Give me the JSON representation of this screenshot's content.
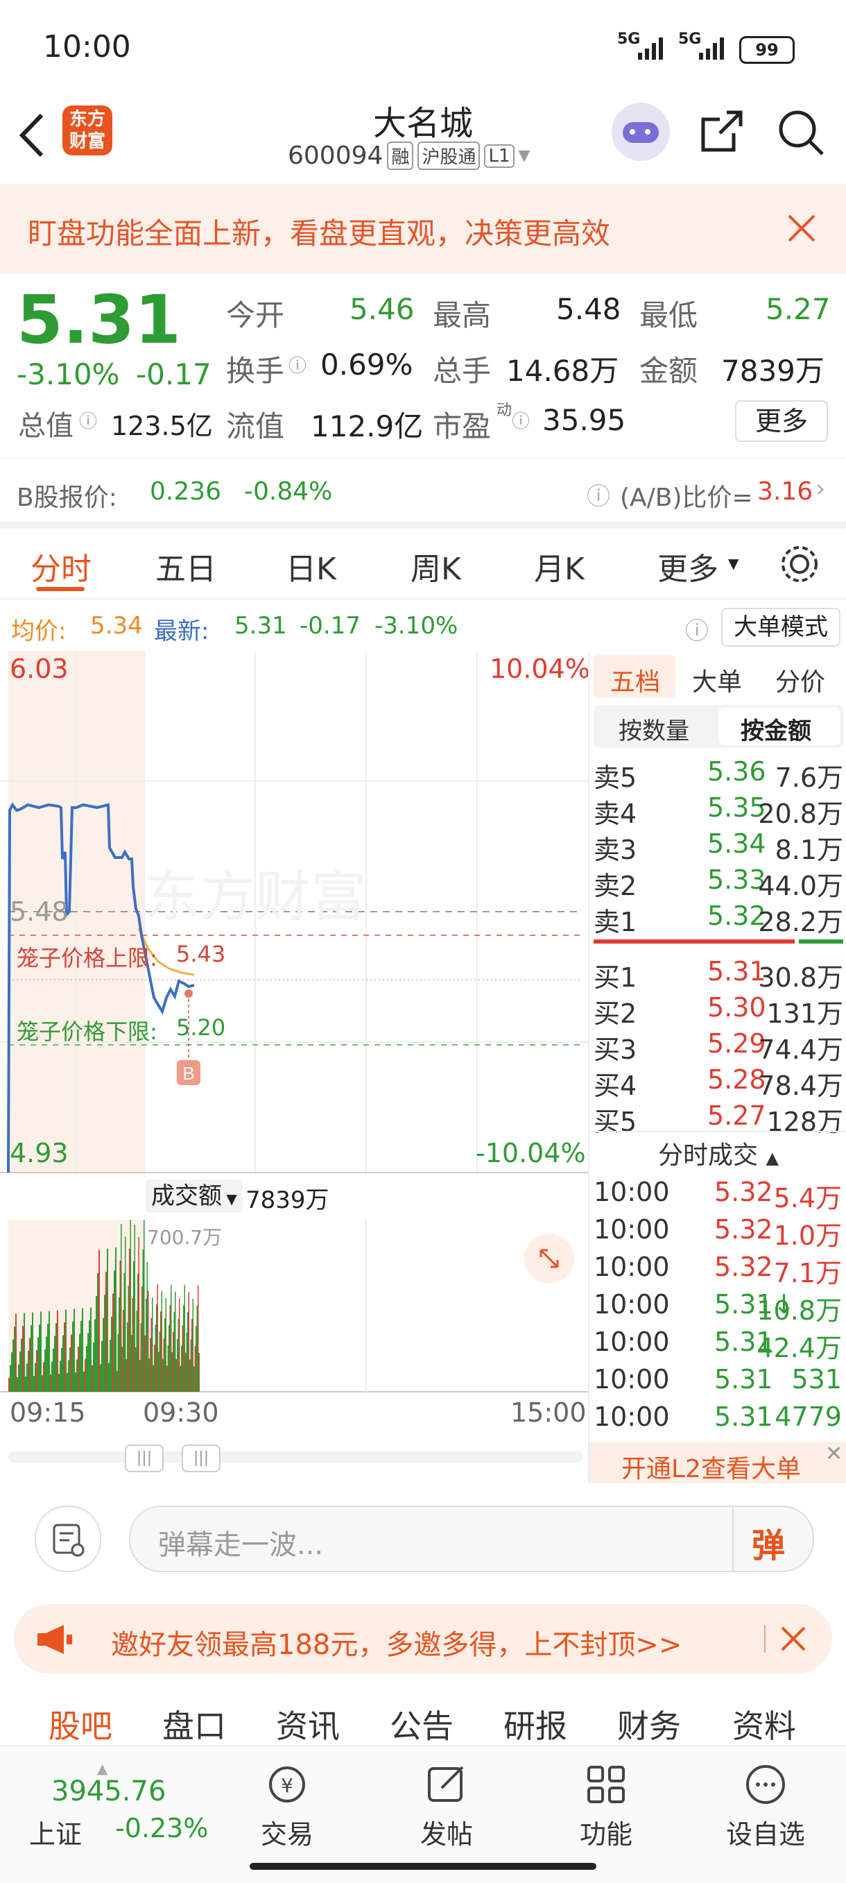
{
  "status": {
    "time": "10:00",
    "signal1": "5G",
    "signal2": "5G",
    "battery": "99"
  },
  "header": {
    "logo_line1": "东方",
    "logo_line2": "财富",
    "stock_name": "大名城",
    "code": "600094",
    "badge1": "融",
    "badge2": "沪股通",
    "badge3": "L1"
  },
  "banner": {
    "text": "盯盘功能全面上新，看盘更直观，决策更高效"
  },
  "quote": {
    "price": "5.31",
    "change_pct": "-3.10%",
    "change": "-0.17",
    "open_label": "今开",
    "open": "5.46",
    "high_label": "最高",
    "high": "5.48",
    "low_label": "最低",
    "low": "5.27",
    "turnover_label": "换手",
    "turnover": "0.69%",
    "volume_label": "总手",
    "volume": "14.68万",
    "amount_label": "金额",
    "amount": "7839万",
    "mktcap_label": "总值",
    "mktcap": "123.5亿",
    "float_label": "流值",
    "float": "112.9亿",
    "pe_label": "市盈",
    "pe_sup": "动",
    "pe": "35.95",
    "more": "更多"
  },
  "bshare": {
    "label": "B股报价:",
    "price": "0.236",
    "pct": "-0.84%",
    "ratio_label": "(A/B)比价=",
    "ratio": "3.16"
  },
  "tabs": {
    "t1": "分时",
    "t2": "五日",
    "t3": "日K",
    "t4": "周K",
    "t5": "月K",
    "t6": "更多"
  },
  "avgline": {
    "avg_label": "均价:",
    "avg": "5.34",
    "latest_label": "最新:",
    "latest": "5.31",
    "chg": "-0.17",
    "pct": "-3.10%",
    "mode": "大单模式"
  },
  "chart": {
    "top_price": "6.03",
    "top_pct": "10.04%",
    "bottom_price": "4.93",
    "bottom_pct": "-10.04%",
    "prev_close_label": "5.48",
    "cage_upper_label": "笼子价格上限:",
    "cage_upper": "5.43",
    "cage_lower_label": "笼子价格下限:",
    "cage_lower": "5.20",
    "marker": "B",
    "vol_select": "成交额",
    "vol_total": "7839万",
    "vol_max": "700.7万",
    "t_start": "09:15",
    "t_mid": "09:30",
    "t_end": "15:00"
  },
  "panel": {
    "tab1": "五档",
    "tab2": "大单",
    "tab3": "分价",
    "sub1": "按数量",
    "sub2": "按金额",
    "asks": [
      {
        "label": "卖5",
        "price": "5.36",
        "vol": "7.6万"
      },
      {
        "label": "卖4",
        "price": "5.35",
        "vol": "20.8万"
      },
      {
        "label": "卖3",
        "price": "5.34",
        "vol": "8.1万"
      },
      {
        "label": "卖2",
        "price": "5.33",
        "vol": "44.0万"
      },
      {
        "label": "卖1",
        "price": "5.32",
        "vol": "28.2万"
      }
    ],
    "bids": [
      {
        "label": "买1",
        "price": "5.31",
        "vol": "30.8万"
      },
      {
        "label": "买2",
        "price": "5.30",
        "vol": "131万"
      },
      {
        "label": "买3",
        "price": "5.29",
        "vol": "74.4万"
      },
      {
        "label": "买4",
        "price": "5.28",
        "vol": "78.4万"
      },
      {
        "label": "买5",
        "price": "5.27",
        "vol": "128万"
      }
    ],
    "ticks_title": "分时成交",
    "ticks": [
      {
        "time": "10:00",
        "price": "5.32",
        "vol": "5.4万"
      },
      {
        "time": "10:00",
        "price": "5.32",
        "vol": "1.0万"
      },
      {
        "time": "10:00",
        "price": "5.32",
        "vol": "7.1万"
      },
      {
        "time": "10:00",
        "price": "5.31↓",
        "vol": "10.8万"
      },
      {
        "time": "10:00",
        "price": "5.31",
        "vol": "42.4万"
      },
      {
        "time": "10:00",
        "price": "5.31",
        "vol": "531"
      },
      {
        "time": "10:00",
        "price": "5.31",
        "vol": "4779"
      }
    ],
    "l2": "开通L2查看大单"
  },
  "comment": {
    "placeholder": "弹幕走一波...",
    "btn": "弹"
  },
  "invite": {
    "text": "邀好友领最高188元，多邀多得，上不封顶>>"
  },
  "subtabs": [
    "股吧",
    "盘口",
    "资讯",
    "公告",
    "研报",
    "财务",
    "资料"
  ],
  "bottom": {
    "index_value": "3945.76",
    "index_name": "上证",
    "index_pct": "-0.23%",
    "nav": [
      "交易",
      "发帖",
      "功能",
      "设自选"
    ]
  },
  "colors": {
    "red": "#e03c31",
    "green": "#2f9b35",
    "orange": "#f08a24",
    "blue": "#3a6fc4"
  }
}
